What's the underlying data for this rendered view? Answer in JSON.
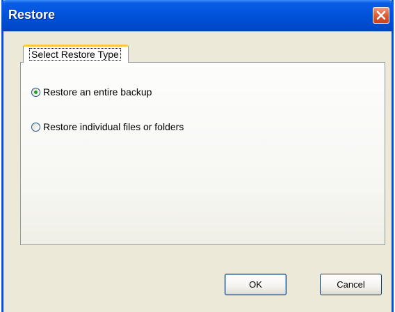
{
  "window": {
    "title": "Restore",
    "close_icon": "close-icon"
  },
  "tab": {
    "label": "Select Restore Type"
  },
  "options": [
    {
      "label": "Restore an entire backup",
      "selected": true
    },
    {
      "label": "Restore individual files or folders",
      "selected": false
    }
  ],
  "buttons": {
    "ok_label": "OK",
    "cancel_label": "Cancel"
  },
  "colors": {
    "titlebar": "#0052d9",
    "close_button": "#e0603a",
    "radio_selected": "#21a121",
    "tab_highlight": "#ffc83c"
  }
}
